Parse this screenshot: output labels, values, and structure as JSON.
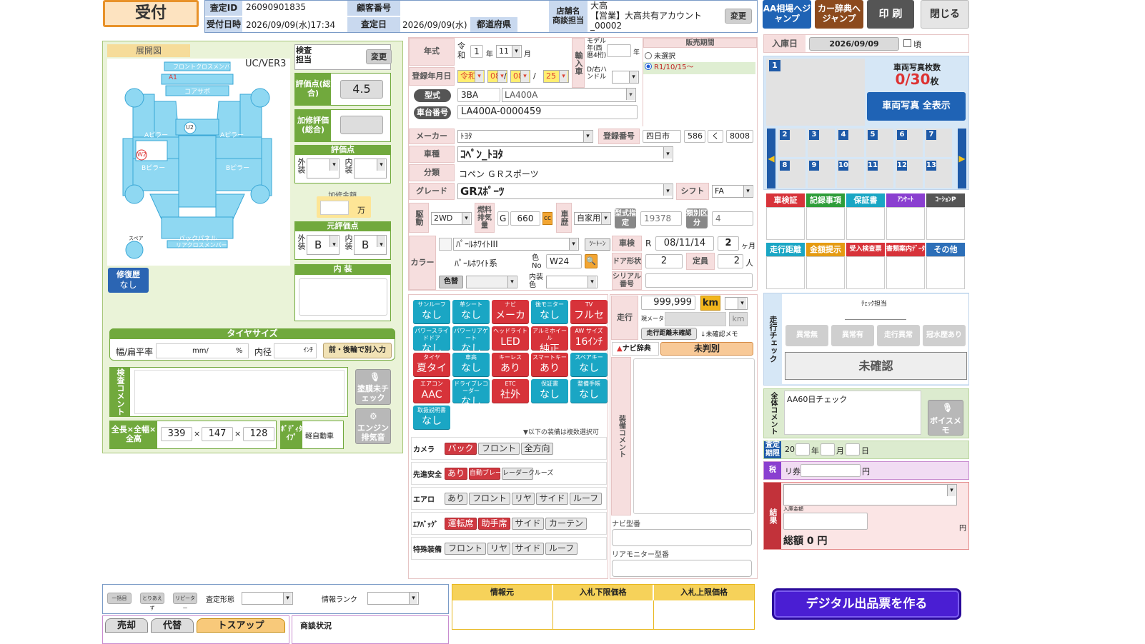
{
  "header": {
    "status_button": "受付",
    "id_label": "査定ID",
    "id_value": "26090901835",
    "customer_no_label": "顧客番号",
    "customer_no_value": "",
    "received_label": "受付日時",
    "received_value": "2026/09/09(水)17:34",
    "assess_date_label": "査定日",
    "assess_date_value": "2026/09/09(水)",
    "prefecture_label": "都道府県",
    "prefecture_value": "",
    "store_label": "店舗名",
    "store_label2": "商談担当",
    "store_name": "大高",
    "store_owner": "【営業】大高共有アカウント",
    "store_code": "_00002",
    "change_label": "変更",
    "btn_aa_market": "AA相場へジャンプ",
    "btn_car_dict": "カー辞典へジャンプ",
    "btn_print": "印 刷",
    "btn_close": "閉じる"
  },
  "diagram": {
    "title": "展開図",
    "version": "UC/VER3",
    "inspector_label": "検査担当",
    "change_label": "変更",
    "score_label": "評価点(総合)",
    "score_value": "4.5",
    "repair_label": "加修評価(総合)",
    "repair_value": "",
    "points_header": "評価点",
    "ext_label": "外装",
    "int_label": "内装",
    "repair_amount_label": "加修金額",
    "repair_amount_unit": "万",
    "orig_points_header": "元評価点",
    "orig_ext_value": "B",
    "orig_int_value": "B",
    "interior_header": "内 装",
    "repair_history_label": "修復歴",
    "repair_history_value": "なし",
    "part_labels": [
      "フロントクロスメンバー",
      "コアサポ",
      "Aピラー",
      "Aピラー",
      "Bピラー",
      "Bピラー",
      "バックパネル",
      "リアクロスメンバー",
      "スペア"
    ],
    "marks": [
      "A1",
      "W2",
      "U2"
    ],
    "tire_header": "タイヤサイズ",
    "tire_width_label": "幅/扁平率",
    "tire_unit1": "mm/",
    "tire_unit2": "%",
    "tire_inner_label": "内径",
    "tire_inner_unit": "ｲﾝﾁ",
    "tire_split_btn": "前・後輪で別入力",
    "inspection_comment_label": "検査コメント",
    "paint_btn": "塗膜未チェック",
    "engine_btn": "エンジン排気音",
    "dims_label": "全長×全幅×全高",
    "length": "339",
    "width": "147",
    "height": "128",
    "body_type_label": "ﾎﾞﾃﾞｨﾀｲﾌﾟ",
    "body_type_value": "軽自動車"
  },
  "vehicle": {
    "year_label": "年式",
    "era": "令和",
    "year": "1",
    "year_unit": "年",
    "month": "11",
    "month_unit": "月",
    "import_label": "輸入車",
    "model_year_label": "モデル年(西暦4桁)",
    "model_year_unit": "年",
    "handle_label": "D/右ハンドル",
    "sale_period_label": "販売期間",
    "sale_opt1": "未選択",
    "sale_opt2": "R1/10/15〜",
    "reg_date_label": "登録年月日",
    "reg_era": "令和",
    "reg_year": "08",
    "reg_month": "08",
    "reg_day": "25",
    "type_label": "型式",
    "type_prefix": "3BA",
    "type_value": "LA400A",
    "chassis_label": "車台番号",
    "chassis_value": "LA400A-0000459",
    "maker_label": "メーカー",
    "maker_value": "ﾄﾖﾀ",
    "plate_label": "登録番号",
    "plate_area": "四日市",
    "plate_class": "586",
    "plate_kana": "く",
    "plate_number": "8008",
    "model_label": "車種",
    "model_value": "ｺﾍﾟﾝ_ﾄﾖﾀ",
    "category_label": "分類",
    "category_value": "コペン ＧＲスポーツ",
    "grade_label": "グレード",
    "grade_value": "GRｽﾎﾟｰﾂ",
    "shift_label": "シフト",
    "shift_value": "FA",
    "drive_label": "駆動",
    "drive_value": "2WD",
    "fuel_label": "燃料排気量",
    "fuel_value": "G",
    "displacement": "660",
    "cc_label": "cc",
    "history_label": "車歴",
    "history_value": "自家用",
    "type_cert_label": "型式指定",
    "type_cert_value": "19378",
    "class_label": "類別区分",
    "class_value": "4",
    "color_label": "カラー",
    "color_name": "ﾊﾟｰﾙﾎﾜｲﾄIII",
    "two_tone": "ﾂｰﾄｰﾝ",
    "color_family": "ﾊﾟｰﾙﾎﾜｲﾄ系",
    "color_no_label": "色No",
    "color_no": "W24",
    "color_swap_label": "色替",
    "interior_color_label": "内装色",
    "inspection_label": "車検",
    "inspection_era": "R",
    "inspection_date": "08/11/14",
    "inspection_months": "2",
    "inspection_unit": "ヶ月",
    "door_label": "ドア形状",
    "door_value": "2",
    "capacity_label": "定員",
    "capacity_value": "2",
    "capacity_unit": "人",
    "serial_label": "シリアル番号"
  },
  "equipment": {
    "tiles": [
      {
        "top": "サンルーフ",
        "val": "なし",
        "color": "teal"
      },
      {
        "top": "革シート",
        "val": "なし",
        "color": "teal"
      },
      {
        "top": "ナビ",
        "val": "メーカー",
        "color": "red"
      },
      {
        "top": "後モニター",
        "val": "なし",
        "color": "teal"
      },
      {
        "top": "TV",
        "val": "フルセグ",
        "color": "red"
      },
      {
        "top": "パワースライドドア",
        "val": "なし",
        "color": "teal"
      },
      {
        "top": "パワーリアゲート",
        "val": "なし",
        "color": "teal"
      },
      {
        "top": "ヘッドライト",
        "val": "LED",
        "color": "red"
      },
      {
        "top": "アルミホイール",
        "val": "純正",
        "color": "red"
      },
      {
        "top": "AW サイズ",
        "val": "16ｲﾝﾁ",
        "color": "red"
      },
      {
        "top": "タイヤ",
        "val": "夏タイヤ",
        "color": "red"
      },
      {
        "top": "車高",
        "val": "なし",
        "color": "teal"
      },
      {
        "top": "キーレス",
        "val": "あり",
        "color": "red"
      },
      {
        "top": "スマートキー",
        "val": "あり",
        "color": "red"
      },
      {
        "top": "スペアキー",
        "val": "なし",
        "color": "teal"
      },
      {
        "top": "エアコン",
        "val": "AAC",
        "color": "red"
      },
      {
        "top": "ドライブレコーダー",
        "val": "なし",
        "color": "teal"
      },
      {
        "top": "ETC",
        "val": "社外",
        "color": "red"
      },
      {
        "top": "保証書",
        "val": "なし",
        "color": "teal"
      },
      {
        "top": "整備手帳",
        "val": "なし",
        "color": "teal"
      },
      {
        "top": "取扱説明書",
        "val": "なし",
        "color": "teal"
      }
    ],
    "multi_note": "▼以下の装備は複数選択可",
    "rows": [
      {
        "label": "カメラ",
        "chips": [
          {
            "t": "バック",
            "on": true
          },
          {
            "t": "フロント",
            "on": false
          },
          {
            "t": "全方向",
            "on": false
          }
        ]
      },
      {
        "label": "先進安全",
        "chips": [
          {
            "t": "あり",
            "on": true
          },
          {
            "t": "自動ブレーキ",
            "on": true
          },
          {
            "t": "レーダークルーズ",
            "on": false
          }
        ]
      },
      {
        "label": "エアロ",
        "chips": [
          {
            "t": "あり",
            "on": false
          },
          {
            "t": "フロント",
            "on": false
          },
          {
            "t": "リヤ",
            "on": false
          },
          {
            "t": "サイド",
            "on": false
          },
          {
            "t": "ルーフ",
            "on": false
          }
        ]
      },
      {
        "label": "ｴｱﾊﾞｯｸﾞ",
        "chips": [
          {
            "t": "運転席",
            "on": true
          },
          {
            "t": "助手席",
            "on": true
          },
          {
            "t": "サイド",
            "on": false
          },
          {
            "t": "カーテン",
            "on": false
          }
        ]
      },
      {
        "label": "特殊装備",
        "chips": [
          {
            "t": "フロント",
            "on": false
          },
          {
            "t": "リヤ",
            "on": false
          },
          {
            "t": "サイド",
            "on": false
          },
          {
            "t": "ルーフ",
            "on": false
          }
        ]
      }
    ]
  },
  "mileage": {
    "label": "走行",
    "value": "999,999",
    "unit": "km",
    "current_meter_label": "現メーター",
    "km_label": "km",
    "unconfirmed_btn": "走行距離未確認",
    "unconfirmed_memo": "↓未確認メモ",
    "navi_dict": "ナビ辞典",
    "undetermined": "未判別",
    "equipment_comment_label": "装備コメント",
    "navi_model_label": "ナビ型番",
    "rear_monitor_label": "リアモニター型番"
  },
  "right": {
    "arrival_label": "入庫日",
    "arrival_date": "2026/09/09",
    "arrival_approx": "頃",
    "photo_count_label": "車両写真枚数",
    "photo_count": "0/30",
    "photo_unit": "枚",
    "photo_all_btn": "車両写真 全表示",
    "thumbs": [
      "1",
      "2",
      "3",
      "4",
      "5",
      "6",
      "7",
      "8",
      "9",
      "10",
      "11",
      "12",
      "13"
    ],
    "docs1": [
      {
        "label": "車検証",
        "color": "#d7333a"
      },
      {
        "label": "記録事項",
        "color": "#2f9d3a"
      },
      {
        "label": "保証書",
        "color": "#1aa6c4"
      },
      {
        "label": "ｱﾝｹｰﾄ",
        "color": "#8a3fd0"
      },
      {
        "label": "ｺｰｼｮﾝP",
        "color": "#555555"
      }
    ],
    "docs2": [
      {
        "label": "走行距離",
        "color": "#1aa6c4"
      },
      {
        "label": "金額提示",
        "color": "#e59b12"
      },
      {
        "label": "受入検査票",
        "color": "#d7333a"
      },
      {
        "label": "書類案内ﾃﾞｰﾀ",
        "color": "#d7333a"
      },
      {
        "label": "その他",
        "color": "#2d6fb8"
      }
    ],
    "run_check_label": "走行チェック",
    "check_person_label": "ﾁｪｯｸ担当",
    "check_btns": [
      "異常無",
      "異常有",
      "走行異常",
      "冠水歴あり"
    ],
    "unconfirmed": "未確認",
    "overall_comment_label": "全体コメント",
    "overall_comment": "AA60日チェック",
    "voice_memo": "ボイスメモ",
    "deadline_label": "査定期限",
    "deadline_prefix": "20",
    "year_unit": "年",
    "month_unit": "月",
    "day_unit": "日",
    "tax_label": "税",
    "tax_prefix": "リ券",
    "tax_unit": "円",
    "result_label": "結果",
    "arrival_amount_label": "入庫金額",
    "yen": "円",
    "total_label": "総額 0 円"
  },
  "bottom": {
    "btn1": "一括目",
    "btn2": "とりあえず",
    "btn3": "リピーター",
    "shape_label": "査定形態",
    "info_rank_label": "情報ランク",
    "tabs": [
      "売却",
      "代替",
      "トスアップ"
    ],
    "nego_label": "商談状況",
    "info_source": "情報元",
    "bid_min": "入札下限価格",
    "bid_max": "入札上限価格",
    "digital_btn": "デジタル出品票を作る"
  }
}
